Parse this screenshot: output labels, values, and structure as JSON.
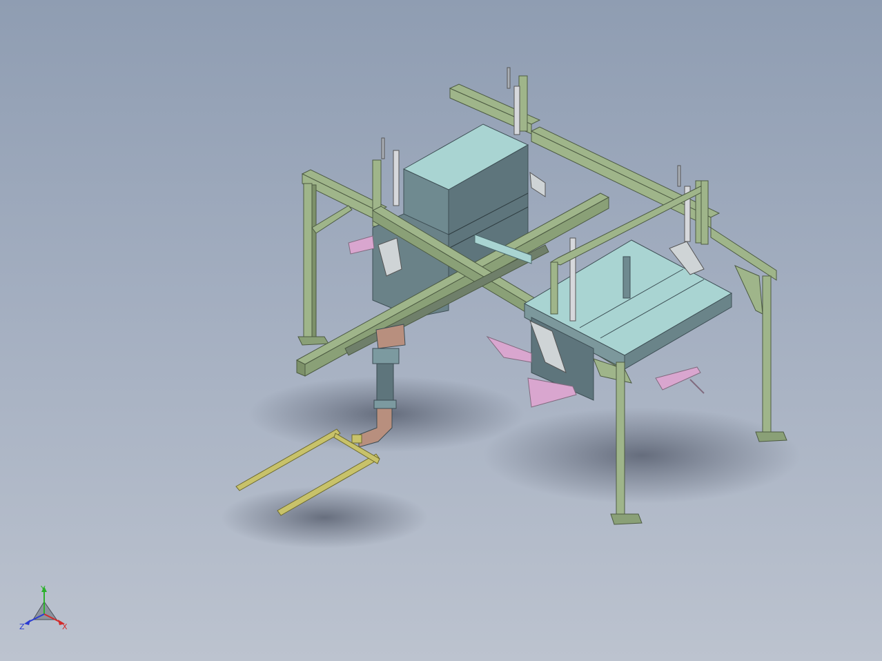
{
  "triad": {
    "y_label": "Y",
    "x_label": "X",
    "z_label": "Z"
  },
  "colors": {
    "frame": "#9fb58a",
    "frame_dark": "#5f7150",
    "hopper_top": "#a9d4d2",
    "hopper_side": "#6f8a90",
    "hopper_front": "#5e757c",
    "pink_part": "#d9a6cf",
    "rail_yellow": "#c8c26a",
    "duct_brown": "#b88f7e",
    "y_axis": "#2bb12b",
    "x_axis": "#d22b2b",
    "z_axis": "#2b3bd2"
  }
}
